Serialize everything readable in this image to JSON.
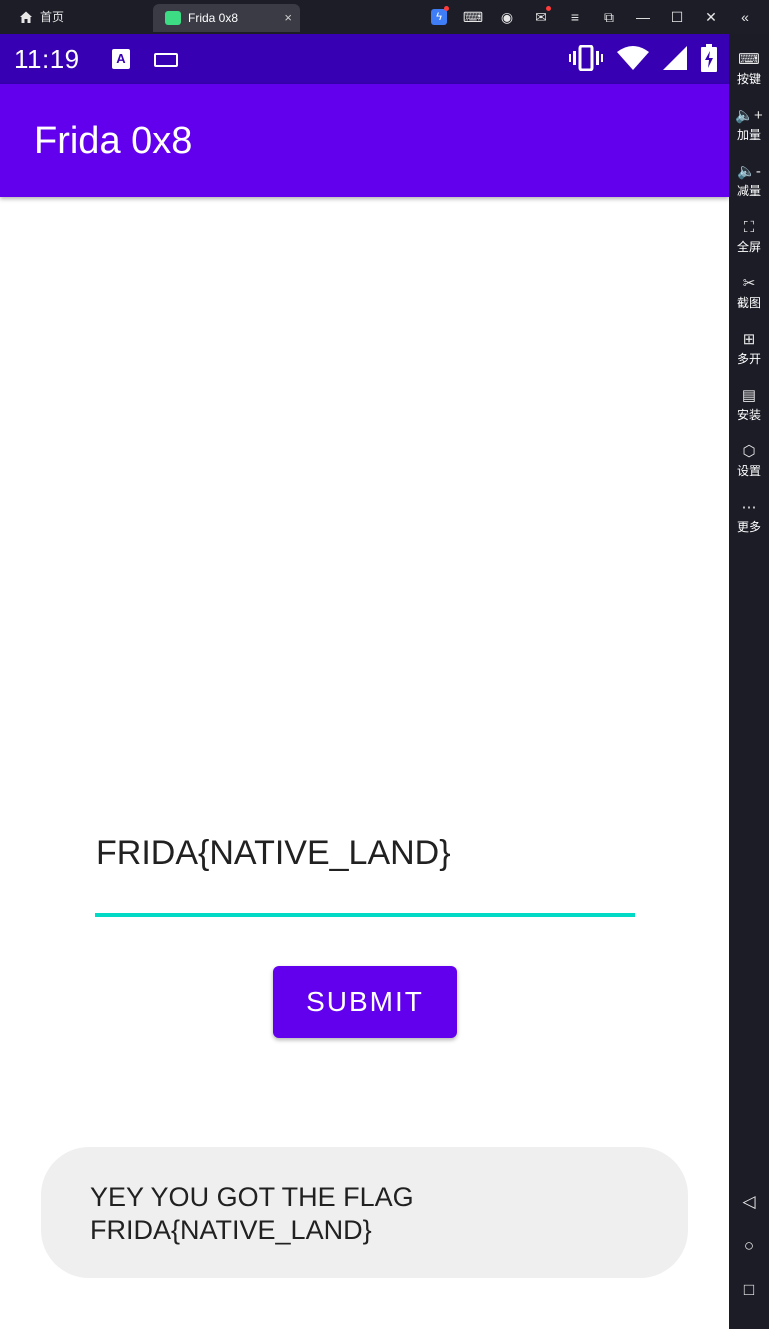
{
  "window": {
    "home_tab_label": "首页",
    "app_tab_label": "Frida 0x8",
    "tab_close": "×",
    "controls": [
      {
        "name": "bolt-icon",
        "glyph": "ϟ"
      },
      {
        "name": "gamepad-icon",
        "glyph": "⌨"
      },
      {
        "name": "account-icon",
        "glyph": "◉"
      },
      {
        "name": "mail-icon",
        "glyph": "✉"
      },
      {
        "name": "menu-icon",
        "glyph": "≡"
      },
      {
        "name": "restore-icon",
        "glyph": "⧉"
      },
      {
        "name": "minimize-icon",
        "glyph": "—"
      },
      {
        "name": "maximize-icon",
        "glyph": "☐"
      },
      {
        "name": "close-icon",
        "glyph": "✕"
      },
      {
        "name": "collapse-icon",
        "glyph": "«"
      }
    ]
  },
  "status_bar": {
    "time": "11:19",
    "a_badge": "A",
    "background": "#3700b3"
  },
  "app_bar": {
    "title": "Frida 0x8",
    "color": "#6200ee"
  },
  "main": {
    "input_value": "FRIDA{NATIVE_LAND}",
    "underline_color": "#03dac5",
    "submit_label": "SUBMIT"
  },
  "toast": {
    "line1": "YEY YOU GOT THE FLAG",
    "line2": "FRIDA{NATIVE_LAND}"
  },
  "sidebar": {
    "items": [
      {
        "label": "按键",
        "icon": "keyboard-icon",
        "glyph": "⌨"
      },
      {
        "label": "加量",
        "icon": "volume-up-icon",
        "glyph": "🔈+"
      },
      {
        "label": "减量",
        "icon": "volume-down-icon",
        "glyph": "🔈-"
      },
      {
        "label": "全屏",
        "icon": "fullscreen-icon",
        "glyph": "⛶"
      },
      {
        "label": "截图",
        "icon": "scissors-icon",
        "glyph": "✂"
      },
      {
        "label": "多开",
        "icon": "multi-instance-icon",
        "glyph": "⊞"
      },
      {
        "label": "安装",
        "icon": "apk-icon",
        "glyph": "▤"
      },
      {
        "label": "设置",
        "icon": "settings-icon",
        "glyph": "⬡"
      },
      {
        "label": "更多",
        "icon": "more-icon",
        "glyph": "⋯"
      }
    ],
    "nav": [
      {
        "icon": "back-icon",
        "glyph": "◁"
      },
      {
        "icon": "home-icon",
        "glyph": "○"
      },
      {
        "icon": "recents-icon",
        "glyph": "□"
      }
    ]
  }
}
